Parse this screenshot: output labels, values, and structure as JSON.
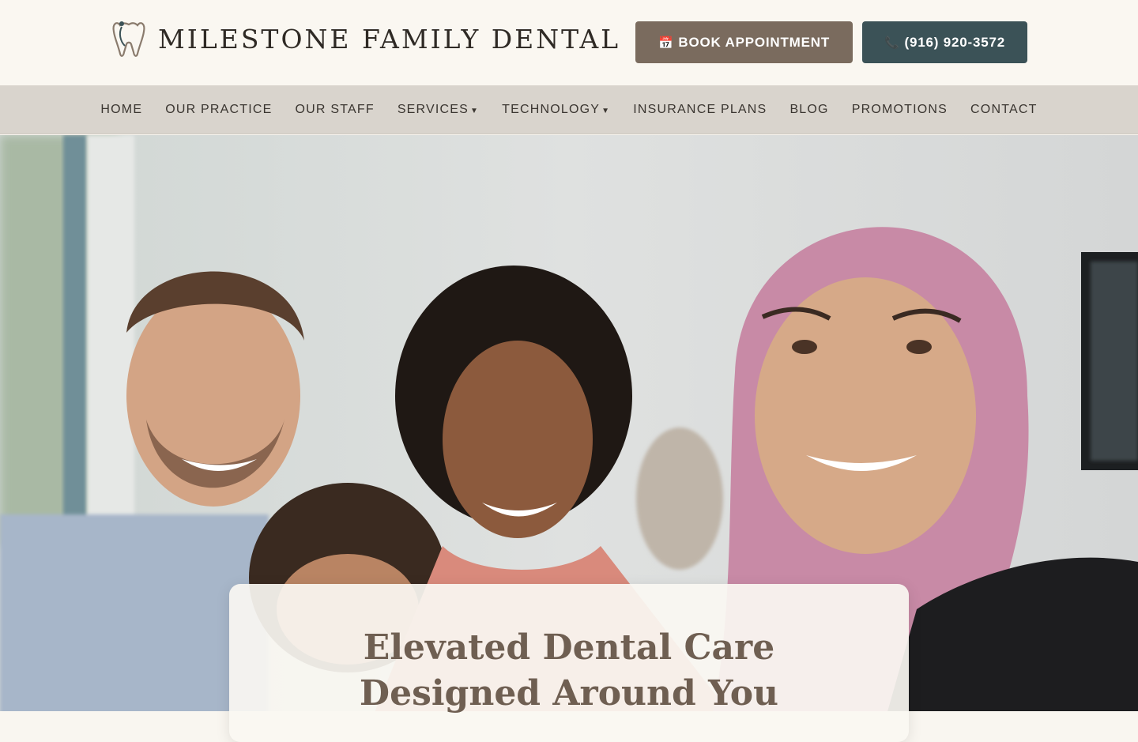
{
  "header": {
    "logo_text": "MILESTONE FAMILY DENTAL",
    "book_label": "BOOK APPOINTMENT",
    "book_icon": "calendar-icon",
    "phone_label": "(916) 920-3572",
    "phone_icon": "phone-icon"
  },
  "nav": {
    "items": [
      {
        "label": "HOME"
      },
      {
        "label": "OUR PRACTICE"
      },
      {
        "label": "OUR STAFF"
      },
      {
        "label": "SERVICES",
        "dropdown": true
      },
      {
        "label": "TECHNOLOGY",
        "dropdown": true
      },
      {
        "label": "INSURANCE PLANS"
      },
      {
        "label": "BLOG"
      },
      {
        "label": "PROMOTIONS"
      },
      {
        "label": "CONTACT"
      }
    ]
  },
  "hero": {
    "image": "family-with-dentist-photo",
    "title": "Elevated Dental Care Designed Around You"
  },
  "colors": {
    "header_bg": "#faf7f1",
    "nav_bg": "#d9d4cd",
    "book_button": "#7a6b5e",
    "phone_button": "#3b5257",
    "title_color": "#6f5f52"
  }
}
